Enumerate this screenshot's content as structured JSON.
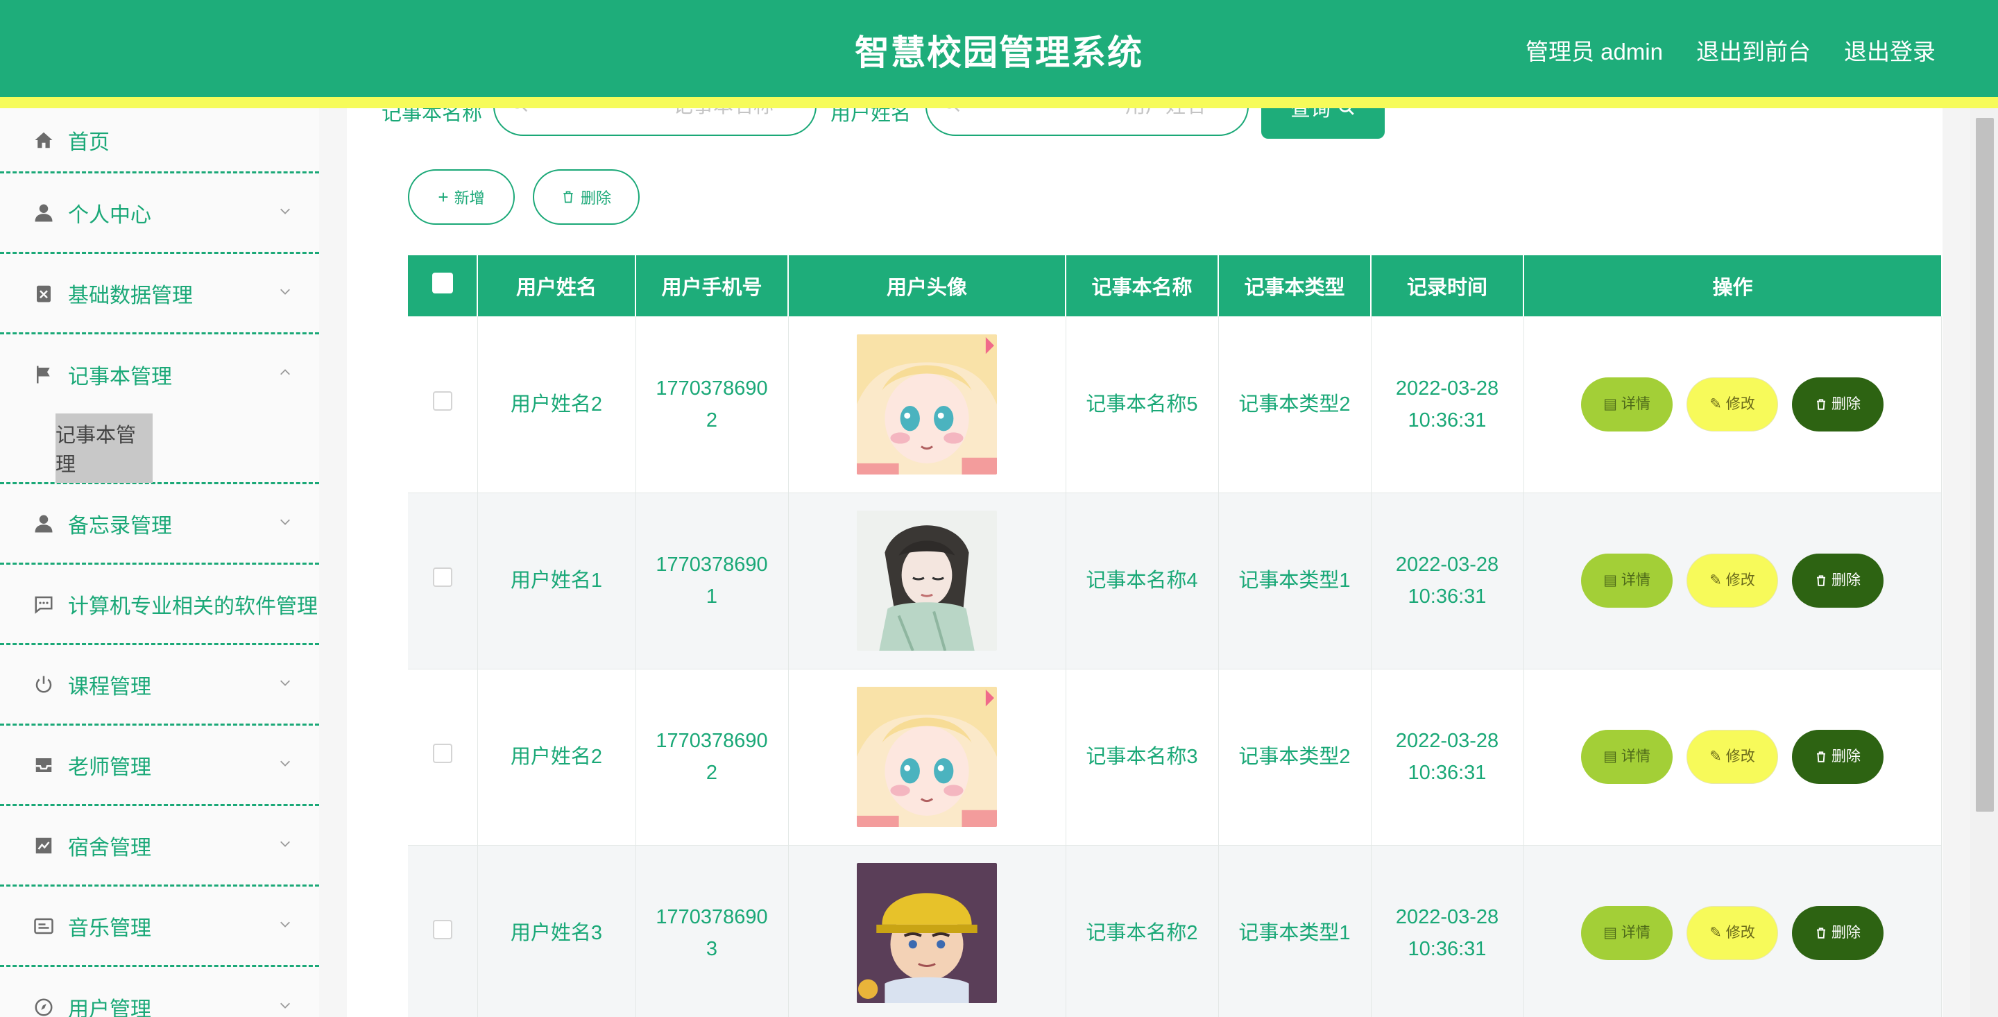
{
  "header": {
    "title": "智慧校园管理系统",
    "admin_label": "管理员 admin",
    "frontend_link": "退出到前台",
    "logout_link": "退出登录",
    "colors": {
      "primary": "#1ead7a",
      "stripe": "#f6fb5a"
    }
  },
  "sidebar": {
    "items": [
      {
        "label": "首页",
        "icon": "home-icon"
      },
      {
        "label": "个人中心",
        "icon": "user-icon"
      },
      {
        "label": "基础数据管理",
        "icon": "clipboard-icon"
      },
      {
        "label": "记事本管理",
        "icon": "flag-icon",
        "expanded": true,
        "sub": "记事本管理"
      },
      {
        "label": "备忘录管理",
        "icon": "user-icon"
      },
      {
        "label": "计算机专业相关的软件管理",
        "icon": "chat-icon"
      },
      {
        "label": "课程管理",
        "icon": "power-icon"
      },
      {
        "label": "老师管理",
        "icon": "inbox-icon"
      },
      {
        "label": "宿舍管理",
        "icon": "chart-icon"
      },
      {
        "label": "音乐管理",
        "icon": "card-icon"
      },
      {
        "label": "用户管理",
        "icon": "compass-icon"
      }
    ]
  },
  "search": {
    "notebook_label": "记事本名称",
    "notebook_placeholder": "记事本名称",
    "user_label": "用户姓名",
    "user_placeholder": "用户姓名",
    "query_button": "查询"
  },
  "toolbar": {
    "add_label": "新增",
    "delete_label": "删除"
  },
  "table": {
    "headers": [
      "用户姓名",
      "用户手机号",
      "用户头像",
      "记事本名称",
      "记事本类型",
      "记录时间",
      "操作"
    ],
    "rows": [
      {
        "name": "用户姓名2",
        "phone_1": "1770378690",
        "phone_2": "2",
        "avatar": "blonde-girl",
        "notebook": "记事本名称5",
        "type": "记事本类型2",
        "date": "2022-03-28",
        "time": "10:36:31"
      },
      {
        "name": "用户姓名1",
        "phone_1": "1770378690",
        "phone_2": "1",
        "avatar": "dark-hair-girl",
        "notebook": "记事本名称4",
        "type": "记事本类型1",
        "date": "2022-03-28",
        "time": "10:36:31"
      },
      {
        "name": "用户姓名2",
        "phone_1": "1770378690",
        "phone_2": "2",
        "avatar": "blonde-girl",
        "notebook": "记事本名称3",
        "type": "记事本类型2",
        "date": "2022-03-28",
        "time": "10:36:31"
      },
      {
        "name": "用户姓名3",
        "phone_1": "1770378690",
        "phone_2": "3",
        "avatar": "yellow-hat-boy",
        "notebook": "记事本名称2",
        "type": "记事本类型1",
        "date": "2022-03-28",
        "time": "10:36:31"
      }
    ],
    "actions": {
      "detail": "详情",
      "edit": "修改",
      "delete": "删除"
    }
  }
}
